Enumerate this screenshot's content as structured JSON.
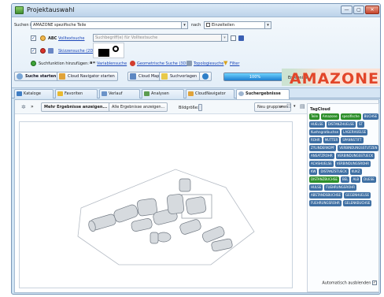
{
  "window": {
    "title": "Projektauswahl",
    "controls": [
      "—",
      "▢",
      "✕"
    ]
  },
  "search": {
    "label_in": "Suchen in",
    "scope_value": "AMAZONE spezifische Teile",
    "label_by": "nach",
    "mode_value": "Einzelteilen",
    "fulltext_link": "Volltextsuche",
    "fulltext_placeholder": "Suchbegriff(e) für Volltextsuche",
    "sketch_link": "Skizzensuche (2D)",
    "add_label": "Suchfunktion hinzufügen:",
    "add_variables": "Variablensuche",
    "add_geometric": "Geometrische Suche (3D)",
    "add_topology": "Topologiesuche",
    "add_filter": "Filter",
    "abc_label": "ABC"
  },
  "actions": {
    "start_search": "Suche starten",
    "cloud_navigator_start": "Cloud Navigator starten",
    "cloud_map": "Cloud Map",
    "search_templates": "Suchvorlagen",
    "progress_text": "100%",
    "progress": 1.0,
    "progress_suffix": "Ergebniss"
  },
  "brand": {
    "name": "AMAZONE",
    "color": "#e2462a"
  },
  "tabs": [
    "Kataloge",
    "Favoriten",
    "Verlauf",
    "Analysen",
    "CloudNavigator",
    "Suchergebnisse"
  ],
  "results_toolbar": {
    "more_results": "Mehr Ergebnisse anzeigen...",
    "all_results": "Alle Ergebnisse anzeigen...",
    "image_size": "Bildgröße:",
    "regroup": "Neu gruppieren"
  },
  "tagcloud": {
    "title": "TagCloud",
    "tags": [
      {
        "text": "Teile",
        "green": true
      },
      {
        "text": "Amazone",
        "green": true
      },
      {
        "text": "spezifische",
        "green": true
      },
      {
        "text": "BUCHSE",
        "green": false
      },
      {
        "text": "HUELSE",
        "green": false
      },
      {
        "text": "DISTANZHUELSE",
        "green": false
      },
      {
        "text": "ST",
        "green": false
      },
      {
        "text": "Kuehngratbuchse",
        "green": false
      },
      {
        "text": "LAGERHUELSE",
        "green": false
      },
      {
        "text": "ROHR",
        "green": false
      },
      {
        "text": "MUTTER",
        "green": false
      },
      {
        "text": "SPANNSTIFT",
        "green": false
      },
      {
        "text": "ZYLINDERKOPF",
        "green": false
      },
      {
        "text": "VERBINDUNGSSTUTZEN",
        "green": false
      },
      {
        "text": "ANSATZROHR",
        "green": false
      },
      {
        "text": "VERBINDUNGSSTUECK",
        "green": false
      },
      {
        "text": "ACHSHUELSE",
        "green": false
      },
      {
        "text": "VERBINDUNGSROHR",
        "green": false
      },
      {
        "text": "KW",
        "green": false
      },
      {
        "text": "DISTANZSTUECK",
        "green": false
      },
      {
        "text": "KUKZ",
        "green": false
      },
      {
        "text": "DISTANZBUCHSE",
        "green": true
      },
      {
        "text": "BEL",
        "green": false
      },
      {
        "text": "ALB",
        "green": false
      },
      {
        "text": "DUESE",
        "green": false
      },
      {
        "text": "HULSE",
        "green": false
      },
      {
        "text": "FUEHRUNGSROHR",
        "green": false
      },
      {
        "text": "ABSTANDSBUCHSE",
        "green": false
      },
      {
        "text": "GEGENHUELSE",
        "green": false
      },
      {
        "text": "FUEHRUNGSROHR",
        "green": false
      },
      {
        "text": "GELENKBUCHSE",
        "green": false
      }
    ],
    "autohide": "Automatisch ausblenden"
  }
}
